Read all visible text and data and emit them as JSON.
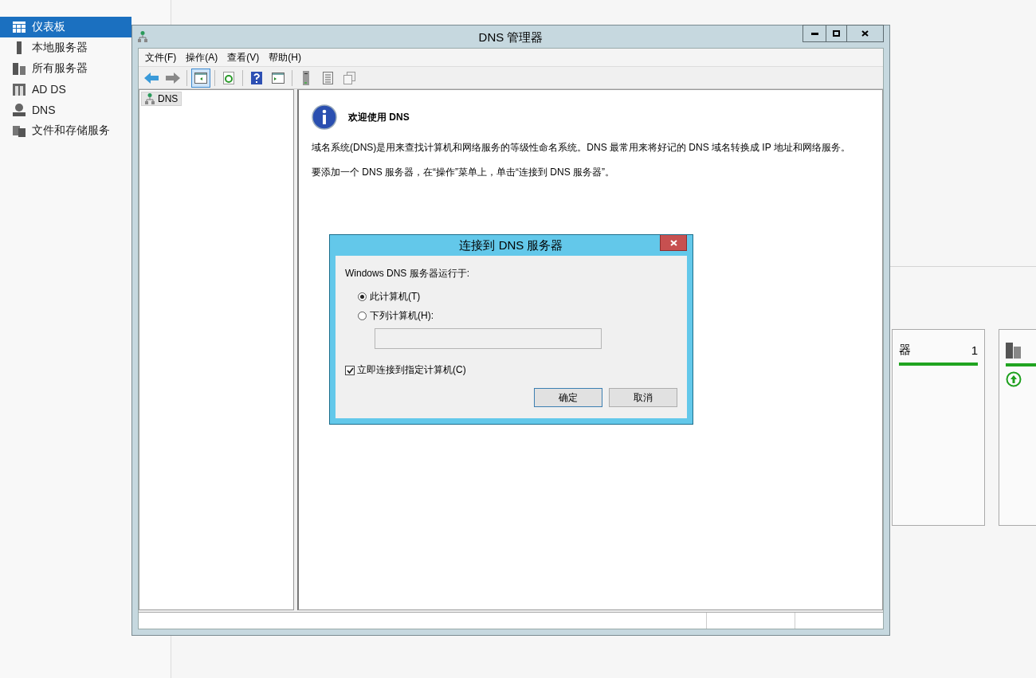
{
  "server_manager": {
    "sidebar": {
      "items": [
        {
          "label": "仪表板",
          "kind": "dashboard",
          "selected": true
        },
        {
          "label": "本地服务器",
          "kind": "server",
          "selected": false
        },
        {
          "label": "所有服务器",
          "kind": "servers",
          "selected": false
        },
        {
          "label": "AD DS",
          "kind": "adds",
          "selected": false
        },
        {
          "label": "DNS",
          "kind": "dns",
          "selected": false
        },
        {
          "label": "文件和存储服务",
          "kind": "files",
          "selected": false
        }
      ]
    },
    "tile": {
      "title": "器",
      "count": "1"
    }
  },
  "dns_window": {
    "title": "DNS 管理器",
    "menu": [
      "文件(F)",
      "操作(A)",
      "查看(V)",
      "帮助(H)"
    ],
    "toolbar": [
      {
        "kind": "back",
        "pressed": false
      },
      {
        "kind": "forward",
        "pressed": false
      },
      {
        "kind": "sep"
      },
      {
        "kind": "tree",
        "pressed": true
      },
      {
        "kind": "sep"
      },
      {
        "kind": "refresh",
        "pressed": false
      },
      {
        "kind": "sep"
      },
      {
        "kind": "help",
        "pressed": false
      },
      {
        "kind": "panel",
        "pressed": false
      },
      {
        "kind": "sep"
      },
      {
        "kind": "server",
        "pressed": false
      },
      {
        "kind": "list",
        "pressed": false
      },
      {
        "kind": "copy",
        "pressed": false
      }
    ],
    "tree": [
      {
        "label": "DNS",
        "selected": true
      }
    ],
    "welcome": {
      "heading": "欢迎使用 DNS",
      "paragraphs": [
        "域名系统(DNS)是用来查找计算机和网络服务的等级性命名系统。DNS 最常用来将好记的 DNS 域名转换成 IP 地址和网络服务。",
        "要添加一个 DNS 服务器，在“操作”菜单上，单击“连接到 DNS 服务器”。"
      ]
    }
  },
  "dialog": {
    "title": "连接到 DNS 服务器",
    "prompt": "Windows DNS 服务器运行于:",
    "options": [
      {
        "label": "此计算机(T)",
        "selected": true
      },
      {
        "label": "下列计算机(H):",
        "selected": false
      }
    ],
    "computer_field": {
      "disabled": true
    },
    "connect_now": {
      "label": "立即连接到指定计算机(C)",
      "checked": true
    },
    "buttons": [
      {
        "label": "确定",
        "default": true
      },
      {
        "label": "取消",
        "default": false
      }
    ]
  }
}
